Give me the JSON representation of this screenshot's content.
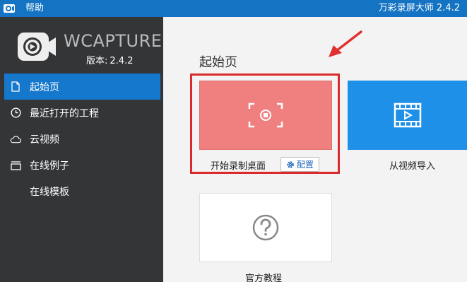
{
  "titlebar": {
    "menu_help": "帮助",
    "window_title": "万彩录屏大师 2.4.2",
    "bg_color": "#1473c2"
  },
  "sidebar": {
    "brand": "WCAPTURE",
    "version_label": "版本:",
    "version_value": "2.4.2",
    "items": [
      {
        "label": "起始页",
        "icon": "document-icon",
        "active": true
      },
      {
        "label": "最近打开的工程",
        "icon": "clock-icon",
        "active": false
      },
      {
        "label": "云视频",
        "icon": "cloud-icon",
        "active": false
      },
      {
        "label": "在线例子",
        "icon": "folder-icon",
        "active": false
      },
      {
        "label": "在线模板",
        "icon": "",
        "active": false
      }
    ],
    "active_color": "#1578cc"
  },
  "main": {
    "page_title": "起始页",
    "cards": {
      "record": {
        "label": "开始录制桌面",
        "icon": "record-screen-icon",
        "color": "#f08080"
      },
      "import": {
        "label": "从视频导入",
        "icon": "video-import-icon",
        "color": "#1e90e8"
      },
      "tutorial": {
        "label": "官方教程",
        "icon": "question-icon"
      }
    },
    "config_button": "配置",
    "highlight_color": "#d92b2b"
  }
}
